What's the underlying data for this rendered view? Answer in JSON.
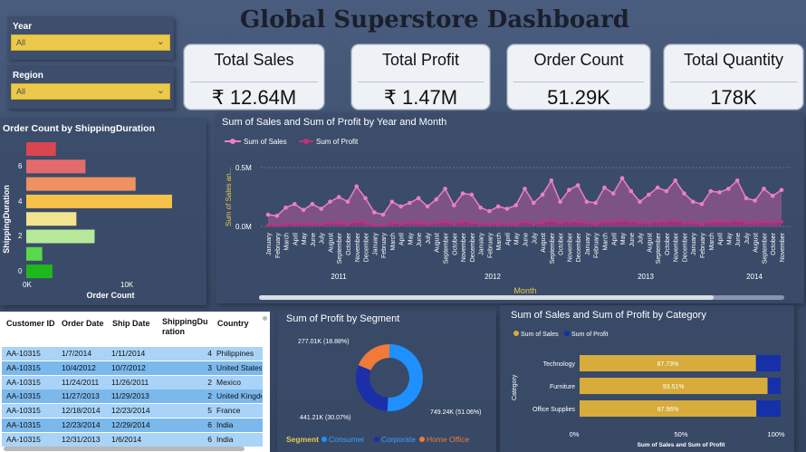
{
  "title": "Global Superstore Dashboard",
  "slicers": {
    "year": {
      "label": "Year",
      "value": "All"
    },
    "region": {
      "label": "Region",
      "value": "All"
    }
  },
  "kpis": [
    {
      "label": "Total Sales",
      "value": "₹ 12.64M"
    },
    {
      "label": "Total Profit",
      "value": "₹ 1.47M"
    },
    {
      "label": "Order Count",
      "value": "51.29K"
    },
    {
      "label": "Total Quantity",
      "value": "178K"
    }
  ],
  "shipping_chart": {
    "title": "Order Count by ShippingDuration",
    "xlabel": "Order Count",
    "ylabel": "ShippingDuration",
    "xticks": [
      "0K",
      "10K"
    ],
    "yticks": [
      "6",
      "4",
      "2",
      "0"
    ]
  },
  "line_chart": {
    "title": "Sum of Sales and Sum of Profit by Year and Month",
    "legend": [
      "Sum of Sales",
      "Sum of Profit"
    ],
    "ylabel": "Sum of Sales an...",
    "yticks": [
      "0.5M",
      "0.0M"
    ],
    "xlabel": "Month",
    "years": [
      "2011",
      "2012",
      "2013",
      "2014"
    ],
    "months": [
      "January",
      "February",
      "March",
      "April",
      "May",
      "June",
      "July",
      "August",
      "September",
      "October",
      "November",
      "December"
    ]
  },
  "segment_chart": {
    "title": "Sum of Profit by Segment",
    "legend_title": "Segment",
    "labels": [
      "277.01K (18.88%)",
      "441.21K (30.07%)",
      "749.24K (51.06%)"
    ]
  },
  "category_chart": {
    "title": "Sum of Sales and Sum of Profit by Category",
    "legend": [
      "Sum of Sales",
      "Sum of Profit"
    ],
    "ylabel": "Category",
    "xlabel": "Sum of Sales and Sum of Profit",
    "xticks": [
      "0%",
      "50%",
      "100%"
    ]
  },
  "table": {
    "headers": [
      "Customer ID",
      "Order Date",
      "Ship Date",
      "ShippingDu ration",
      "Country"
    ],
    "rows": [
      [
        "AA-10315",
        "1/7/2014",
        "1/11/2014",
        "4",
        "Philippines"
      ],
      [
        "AA-10315",
        "10/4/2012",
        "10/7/2012",
        "3",
        "United States"
      ],
      [
        "AA-10315",
        "11/24/2011",
        "11/26/2011",
        "2",
        "Mexico"
      ],
      [
        "AA-10315",
        "11/27/2013",
        "11/29/2013",
        "2",
        "United Kingdom"
      ],
      [
        "AA-10315",
        "12/18/2014",
        "12/23/2014",
        "5",
        "France"
      ],
      [
        "AA-10315",
        "12/23/2014",
        "12/29/2014",
        "6",
        "India"
      ],
      [
        "AA-10315",
        "12/31/2013",
        "1/6/2014",
        "6",
        "India"
      ]
    ]
  },
  "chart_data": [
    {
      "type": "bar",
      "title": "Order Count by ShippingDuration",
      "xlabel": "Order Count",
      "ylabel": "ShippingDuration",
      "orientation": "horizontal",
      "categories": [
        "7",
        "6",
        "5",
        "4",
        "3",
        "2",
        "1",
        "0"
      ],
      "values": [
        2600,
        5200,
        9600,
        12800,
        4400,
        6000,
        1400,
        2300
      ],
      "colors": [
        "#d9464f",
        "#e46b6b",
        "#ef9160",
        "#f7c24a",
        "#f2e38e",
        "#b6e99a",
        "#58d84a",
        "#1fb81c"
      ],
      "xlim": [
        0,
        14000
      ]
    },
    {
      "type": "line",
      "title": "Sum of Sales and Sum of Profit by Year and Month",
      "xlabel": "Month",
      "ylabel": "Sum of Sales an...",
      "ylim": [
        -0.15,
        0.9
      ],
      "series": [
        {
          "name": "Sum of Sales",
          "values": [
            0.1,
            0.09,
            0.16,
            0.19,
            0.14,
            0.19,
            0.15,
            0.21,
            0.25,
            0.21,
            0.34,
            0.24,
            0.12,
            0.1,
            0.21,
            0.17,
            0.2,
            0.24,
            0.17,
            0.23,
            0.32,
            0.18,
            0.28,
            0.27,
            0.16,
            0.13,
            0.17,
            0.15,
            0.18,
            0.32,
            0.2,
            0.27,
            0.39,
            0.21,
            0.31,
            0.35,
            0.21,
            0.2,
            0.33,
            0.28,
            0.41,
            0.3,
            0.21,
            0.27,
            0.33,
            0.3,
            0.39,
            0.28,
            0.21,
            0.19,
            0.3,
            0.29,
            0.32,
            0.39,
            0.24,
            0.22,
            0.32,
            0.26,
            0.31
          ]
        },
        {
          "name": "Sum of Profit",
          "values": [
            0.01,
            0.01,
            0.02,
            0.02,
            0.02,
            0.02,
            0.02,
            0.03,
            0.03,
            0.02,
            0.04,
            0.03,
            0.01,
            0.01,
            0.03,
            0.02,
            0.03,
            0.03,
            0.02,
            0.03,
            0.04,
            0.02,
            0.04,
            0.03,
            0.02,
            0.02,
            0.02,
            0.02,
            0.02,
            0.04,
            0.02,
            0.03,
            0.05,
            0.03,
            0.04,
            0.04,
            0.03,
            0.02,
            0.04,
            0.04,
            0.05,
            0.04,
            0.03,
            0.03,
            0.04,
            0.04,
            0.05,
            0.03,
            0.03,
            0.02,
            0.04,
            0.04,
            0.04,
            0.05,
            0.03,
            0.03,
            0.04,
            0.03,
            0.04
          ]
        }
      ]
    },
    {
      "type": "pie",
      "title": "Sum of Profit by Segment",
      "categories": [
        "Consumer",
        "Corporate",
        "Home Office"
      ],
      "values": [
        749.24,
        441.21,
        277.01
      ],
      "colors": [
        "#1e90ff",
        "#1a2fa8",
        "#f07a3a"
      ]
    },
    {
      "type": "bar",
      "title": "Sum of Sales and Sum of Profit by Category",
      "orientation": "horizontal",
      "stacked": "100%",
      "categories": [
        "Technology",
        "Furniture",
        "Office Supplies"
      ],
      "series": [
        {
          "name": "Sum of Sales",
          "values": [
            87.73,
            93.51,
            87.96
          ],
          "color": "#d8ac3b"
        },
        {
          "name": "Sum of Profit",
          "values": [
            12.27,
            6.49,
            12.04
          ],
          "color": "#1530a8"
        }
      ],
      "data_labels": [
        "87.73%",
        "93.51%",
        "87.96%"
      ],
      "xlim": [
        0,
        100
      ]
    }
  ]
}
